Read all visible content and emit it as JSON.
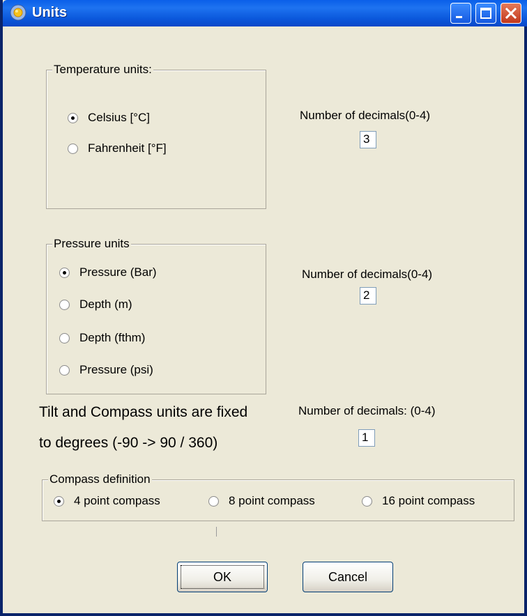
{
  "window": {
    "title": "Units",
    "icon": "sun-icon",
    "controls": [
      "minimize-icon",
      "maximize-icon",
      "close-icon"
    ]
  },
  "temperature": {
    "legend": "Temperature units:",
    "options": [
      "Celsius [°C]",
      "Fahrenheit [°F]"
    ],
    "selected": "Celsius [°C]",
    "decimals_label": "Number of decimals(0-4)",
    "decimals_value": "3"
  },
  "pressure": {
    "legend": "Pressure units",
    "options": [
      "Pressure (Bar)",
      "Depth (m)",
      "Depth (fthm)",
      "Pressure (psi)"
    ],
    "selected": "Pressure (Bar)",
    "decimals_label": "Number of decimals(0-4)",
    "decimals_value": "2"
  },
  "tilt": {
    "line1": "Tilt and Compass units are fixed",
    "line2": "to degrees (-90 -> 90 / 360)",
    "decimals_label": "Number of decimals:  (0-4)",
    "decimals_value": "1"
  },
  "compass": {
    "legend": "Compass definition",
    "options": [
      "4 point compass",
      "8 point compass",
      "16 point compass"
    ],
    "selected": "4 point compass"
  },
  "buttons": {
    "ok": "OK",
    "cancel": "Cancel"
  },
  "colors": {
    "titlebar": "#0A5FE9",
    "dialog_bg": "#ECE9D8",
    "close_button": "#C2381C"
  }
}
